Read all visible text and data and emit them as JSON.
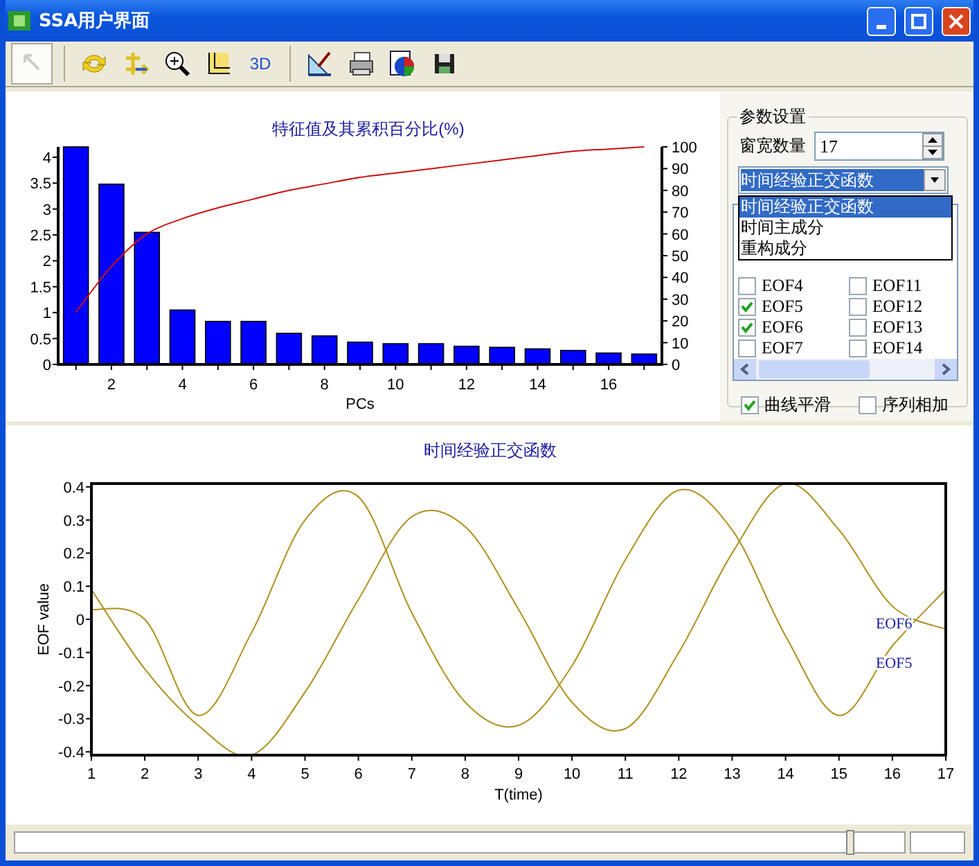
{
  "window": {
    "title": "SSA用户界面"
  },
  "toolbar": {
    "buttons": [
      {
        "kind": "select",
        "pressed": true
      },
      {
        "kind": "rotate",
        "pressed": false
      },
      {
        "kind": "move",
        "pressed": false
      },
      {
        "kind": "zoom",
        "pressed": false
      },
      {
        "kind": "axes",
        "pressed": false
      },
      {
        "kind": "text",
        "label": "3D",
        "pressed": false
      },
      {
        "kind": "draw",
        "pressed": false
      },
      {
        "kind": "print",
        "pressed": false
      },
      {
        "kind": "palette",
        "pressed": false
      },
      {
        "kind": "save",
        "pressed": false
      }
    ]
  },
  "eigen_chart": {
    "chart_data": {
      "type": "bar",
      "title": "特征值及其累积百分比(%)",
      "xlabel": "PCs",
      "x": [
        1,
        2,
        3,
        4,
        5,
        6,
        7,
        8,
        9,
        10,
        11,
        12,
        13,
        14,
        15,
        16,
        17
      ],
      "xlim": [
        0.5,
        17.5
      ],
      "xticks": [
        2,
        4,
        6,
        8,
        10,
        12,
        14,
        16
      ],
      "ylim": [
        0,
        4.2
      ],
      "yticks": [
        0,
        0.5,
        1,
        1.5,
        2,
        2.5,
        3,
        3.5,
        4
      ],
      "y2lim": [
        0,
        100
      ],
      "y2ticks": [
        0,
        10,
        20,
        30,
        40,
        50,
        60,
        70,
        80,
        90,
        100
      ],
      "series": [
        {
          "type": "bar",
          "color": "#0000ff",
          "values": [
            4.2,
            3.48,
            2.55,
            1.05,
            0.83,
            0.83,
            0.6,
            0.55,
            0.43,
            0.4,
            0.4,
            0.35,
            0.33,
            0.3,
            0.27,
            0.22,
            0.2
          ]
        },
        {
          "type": "line",
          "color": "#cc1010",
          "axis": "y2",
          "values": [
            24,
            45,
            60,
            67,
            72,
            76,
            80,
            83,
            86,
            88,
            90,
            92,
            94,
            96,
            98,
            99,
            100
          ]
        }
      ]
    }
  },
  "parameters": {
    "title": "参数设置",
    "window_width": {
      "label": "窗宽数量",
      "value": "17"
    },
    "mode": {
      "value": "时间经验正交函数",
      "expanded": true,
      "options": [
        {
          "label": "时间经验正交函数",
          "selected": true
        },
        {
          "label": "时间主成分",
          "selected": false
        },
        {
          "label": "重构成分",
          "selected": false
        }
      ]
    },
    "eof_list": {
      "columns": [
        [
          {
            "label": "EOF4",
            "checked": false
          },
          {
            "label": "EOF5",
            "checked": true
          },
          {
            "label": "EOF6",
            "checked": true
          },
          {
            "label": "EOF7",
            "checked": false
          }
        ],
        [
          {
            "label": "EOF11",
            "checked": false
          },
          {
            "label": "EOF12",
            "checked": false
          },
          {
            "label": "EOF13",
            "checked": false
          },
          {
            "label": "EOF14",
            "checked": false
          }
        ]
      ]
    },
    "options": [
      {
        "label": "曲线平滑",
        "checked": true
      },
      {
        "label": "序列相加",
        "checked": false
      }
    ]
  },
  "eof_chart": {
    "chart_data": {
      "type": "line",
      "title": "时间经验正交函数",
      "xlabel": "T(time)",
      "ylabel": "EOF value",
      "x": [
        1,
        2,
        3,
        4,
        5,
        6,
        7,
        8,
        9,
        10,
        11,
        12,
        13,
        14,
        15,
        16,
        17
      ],
      "xlim": [
        1,
        17
      ],
      "xticks": [
        1,
        2,
        3,
        4,
        5,
        6,
        7,
        8,
        9,
        10,
        11,
        12,
        13,
        14,
        15,
        16,
        17
      ],
      "ylim": [
        -0.41,
        0.41
      ],
      "yticks": [
        {
          "value": -0.4,
          "label": "-0.4"
        },
        {
          "value": -0.3,
          "label": "-0.3"
        },
        {
          "value": -0.2,
          "label": "-0.2"
        },
        {
          "value": -0.1,
          "label": "-0.1"
        },
        {
          "value": 0,
          "label": "0"
        },
        {
          "value": 0.1,
          "label": "0.1"
        },
        {
          "value": 0.2,
          "label": "0.2"
        },
        {
          "value": 0.3,
          "label": "0.3"
        },
        {
          "value": 0.4,
          "label": "0.4"
        }
      ],
      "series": [
        {
          "name": "EOF5",
          "color": "#b09020",
          "values": [
            0.03,
            0.0,
            -0.29,
            -0.04,
            0.3,
            0.37,
            0.02,
            -0.25,
            -0.32,
            -0.14,
            0.18,
            0.39,
            0.27,
            -0.05,
            -0.29,
            -0.08,
            0.09
          ]
        },
        {
          "name": "EOF6",
          "color": "#b09020",
          "values": [
            0.09,
            -0.15,
            -0.32,
            -0.41,
            -0.22,
            0.06,
            0.31,
            0.28,
            0.03,
            -0.25,
            -0.33,
            -0.1,
            0.2,
            0.41,
            0.27,
            0.04,
            -0.03
          ]
        }
      ]
    }
  },
  "position_slider": {
    "level": 0.94
  }
}
